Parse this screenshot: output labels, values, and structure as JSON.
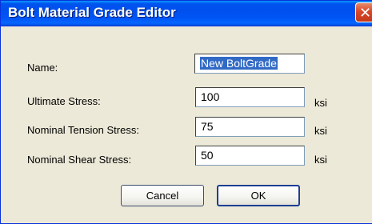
{
  "window": {
    "title": "Bolt Material Grade Editor",
    "close_glyph": "✕"
  },
  "form": {
    "name": {
      "label": "Name:",
      "value": "New BoltGrade"
    },
    "ultimate_stress": {
      "label": "Ultimate Stress:",
      "value": "100",
      "unit": "ksi"
    },
    "nominal_tension_stress": {
      "label": "Nominal Tension Stress:",
      "value": "75",
      "unit": "ksi"
    },
    "nominal_shear_stress": {
      "label": "Nominal Shear Stress:",
      "value": "50",
      "unit": "ksi"
    }
  },
  "buttons": {
    "cancel": "Cancel",
    "ok": "OK"
  }
}
